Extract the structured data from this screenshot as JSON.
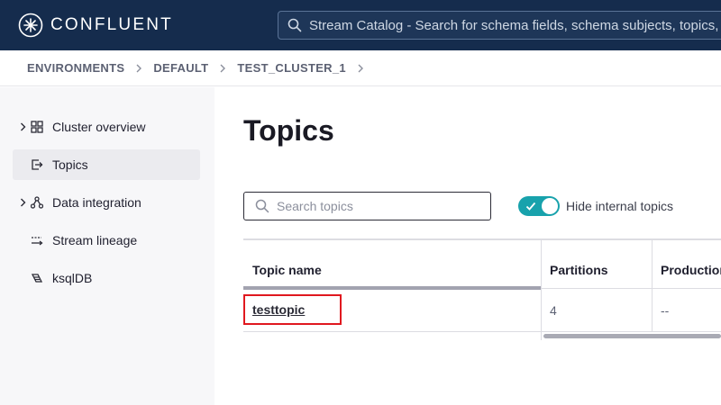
{
  "header": {
    "brand": "CONFLUENT",
    "brand_icon": "confluent-logo-icon",
    "search_placeholder": "Stream Catalog - Search for schema fields, schema subjects, topics, c"
  },
  "breadcrumb": {
    "items": [
      "ENVIRONMENTS",
      "DEFAULT",
      "TEST_CLUSTER_1"
    ]
  },
  "sidebar": {
    "items": [
      {
        "label": "Cluster overview",
        "icon": "grid-icon",
        "expandable": true,
        "active": false
      },
      {
        "label": "Topics",
        "icon": "topics-icon",
        "expandable": false,
        "active": true
      },
      {
        "label": "Data integration",
        "icon": "connectors-icon",
        "expandable": true,
        "active": false
      },
      {
        "label": "Stream lineage",
        "icon": "lineage-icon",
        "expandable": false,
        "active": false
      },
      {
        "label": "ksqlDB",
        "icon": "ksqldb-icon",
        "expandable": false,
        "active": false
      }
    ]
  },
  "main": {
    "title": "Topics",
    "search_placeholder": "Search topics",
    "hide_internal": {
      "label": "Hide internal topics",
      "on": true
    },
    "table": {
      "columns": [
        "Topic name",
        "Partitions",
        "Production"
      ],
      "rows": [
        {
          "name": "testtopic",
          "partitions": "4",
          "production": "--"
        }
      ]
    }
  },
  "colors": {
    "header_bg": "#152c4d",
    "toggle_on": "#18a2ac",
    "highlight": "#e0181f"
  }
}
